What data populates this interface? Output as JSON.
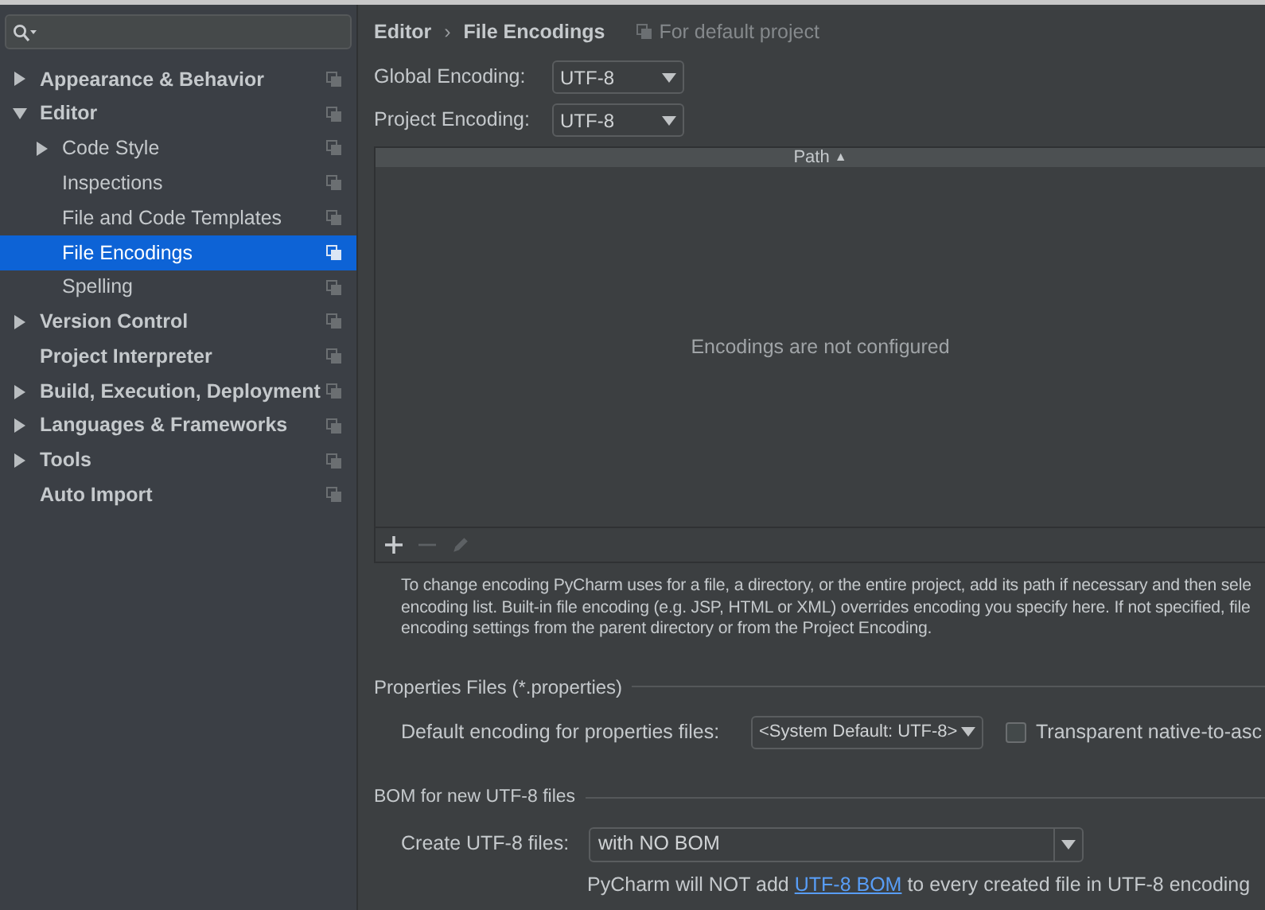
{
  "sidebar": {
    "items": [
      {
        "label": "Appearance & Behavior",
        "kind": "group",
        "expanded": false,
        "selected": false
      },
      {
        "label": "Editor",
        "kind": "group",
        "expanded": true,
        "selected": false,
        "children": [
          {
            "label": "Code Style",
            "kind": "group",
            "expanded": false,
            "selected": false
          },
          {
            "label": "Inspections",
            "kind": "page",
            "selected": false
          },
          {
            "label": "File and Code Templates",
            "kind": "page",
            "selected": false
          },
          {
            "label": "File Encodings",
            "kind": "page",
            "selected": true
          },
          {
            "label": "Spelling",
            "kind": "page",
            "selected": false
          }
        ]
      },
      {
        "label": "Version Control",
        "kind": "group",
        "expanded": false,
        "selected": false
      },
      {
        "label": "Project Interpreter",
        "kind": "page",
        "selected": false
      },
      {
        "label": "Build, Execution, Deployment",
        "kind": "group",
        "expanded": false,
        "selected": false
      },
      {
        "label": "Languages & Frameworks",
        "kind": "group",
        "expanded": false,
        "selected": false
      },
      {
        "label": "Tools",
        "kind": "group",
        "expanded": false,
        "selected": false
      },
      {
        "label": "Auto Import",
        "kind": "page",
        "selected": false
      }
    ]
  },
  "breadcrumb": {
    "parent": "Editor",
    "separator": "›",
    "current": "File Encodings",
    "scope": "For default project"
  },
  "encodings": [
    {
      "label": "Global Encoding:",
      "value": "UTF-8"
    },
    {
      "label": "Project Encoding:",
      "value": "UTF-8"
    }
  ],
  "table": {
    "columns": [
      {
        "label": "Path",
        "sort": "▲"
      }
    ],
    "empty_text": "Encodings are not configured",
    "toolbar": [
      {
        "kind": "add",
        "disabled": false
      },
      {
        "kind": "remove",
        "disabled": true
      },
      {
        "kind": "edit",
        "disabled": true
      }
    ]
  },
  "description": [
    "To change encoding PyCharm uses for a file, a directory, or the entire project, add its path if necessary and then sele",
    "encoding list. Built-in file encoding (e.g. JSP, HTML or XML) overrides encoding you specify here. If not specified, file",
    "encoding settings from the parent directory or from the Project Encoding."
  ],
  "properties": {
    "title": "Properties Files (*.properties)",
    "label": "Default encoding for properties files:",
    "value": "<System Default: UTF-8>",
    "checkbox": {
      "label": "Transparent native-to-asc",
      "checked": false
    }
  },
  "bom": {
    "title": "BOM for new UTF-8 files",
    "label": "Create UTF-8 files:",
    "value": "with NO BOM",
    "note_before": "PyCharm will NOT add ",
    "link": "UTF-8 BOM",
    "note_after": " to every created file in UTF-8 encoding"
  }
}
